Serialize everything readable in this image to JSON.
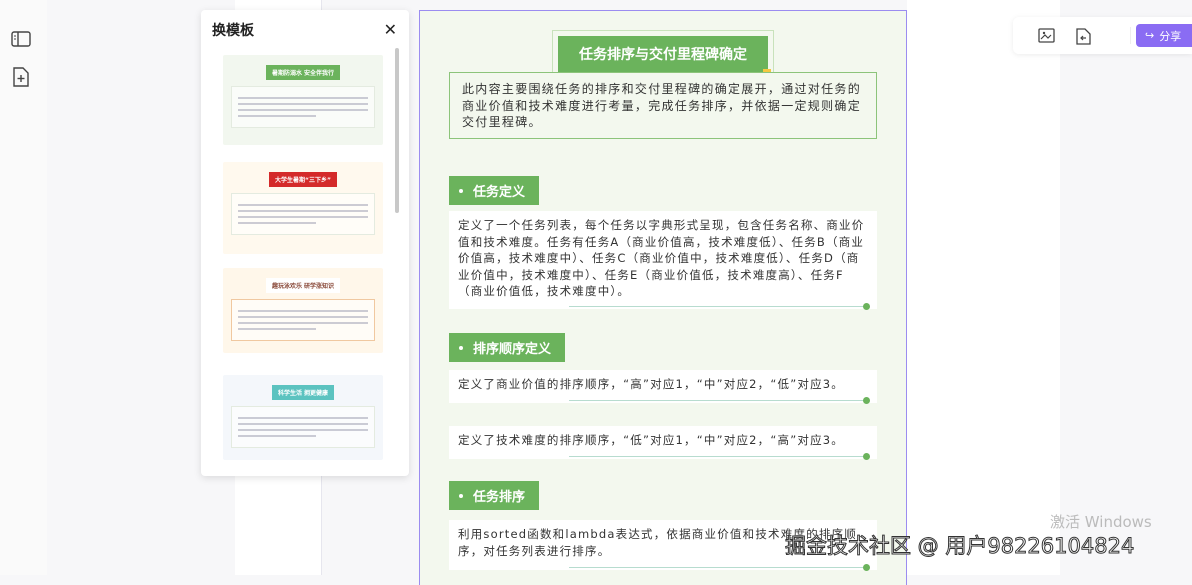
{
  "leftbar": {
    "icons": [
      "layout-panel-icon",
      "add-page-icon"
    ]
  },
  "panel": {
    "title": "换模板",
    "close": "✕",
    "templates": [
      {
        "title": "暑期防溺水 安全伴我行",
        "color": "#6bb35c",
        "bg": "#f2f7ef"
      },
      {
        "title": "大学生暑期“三下乡”",
        "color": "#d42a2a",
        "bg": "#fff9ee"
      },
      {
        "title": "趣玩泳欢乐 研学涨知识",
        "color": "#8a4a3a",
        "bg": "#fff7ea"
      },
      {
        "title": "科学生活 拥更健康",
        "color": "#5cc3c0",
        "bg": "#f4f7fb"
      }
    ]
  },
  "doc": {
    "title": "任务排序与交付里程碑确定",
    "intro": "此内容主要围绕任务的排序和交付里程碑的确定展开，通过对任务的商业价值和技术难度进行考量，完成任务排序，并依据一定规则确定交付里程碑。",
    "sections": [
      {
        "heading": "任务定义",
        "cards": [
          "定义了一个任务列表，每个任务以字典形式呈现，包含任务名称、商业价值和技术难度。任务有任务A（商业价值高，技术难度低）、任务B（商业价值高，技术难度中）、任务C（商业价值中，技术难度低）、任务D（商业价值中，技术难度中）、任务E（商业价值低，技术难度高）、任务F（商业价值低，技术难度中）。"
        ]
      },
      {
        "heading": "排序顺序定义",
        "cards": [
          "定义了商业价值的排序顺序，“高”对应1，“中”对应2，“低”对应3。",
          "定义了技术难度的排序顺序，“低”对应1，“中”对应2，“高”对应3。"
        ]
      },
      {
        "heading": "任务排序",
        "cards": [
          "利用sorted函数和lambda表达式，依据商业价值和技术难度的排序顺序，对任务列表进行排序。"
        ]
      }
    ]
  },
  "toolbar": {
    "share": "分享"
  },
  "watermark": "掘金技术社区 @ 用户98226104824",
  "windows_notice": "激活 Windows",
  "colors": {
    "accent": "#6bb35c",
    "share": "#8a6cf3"
  }
}
